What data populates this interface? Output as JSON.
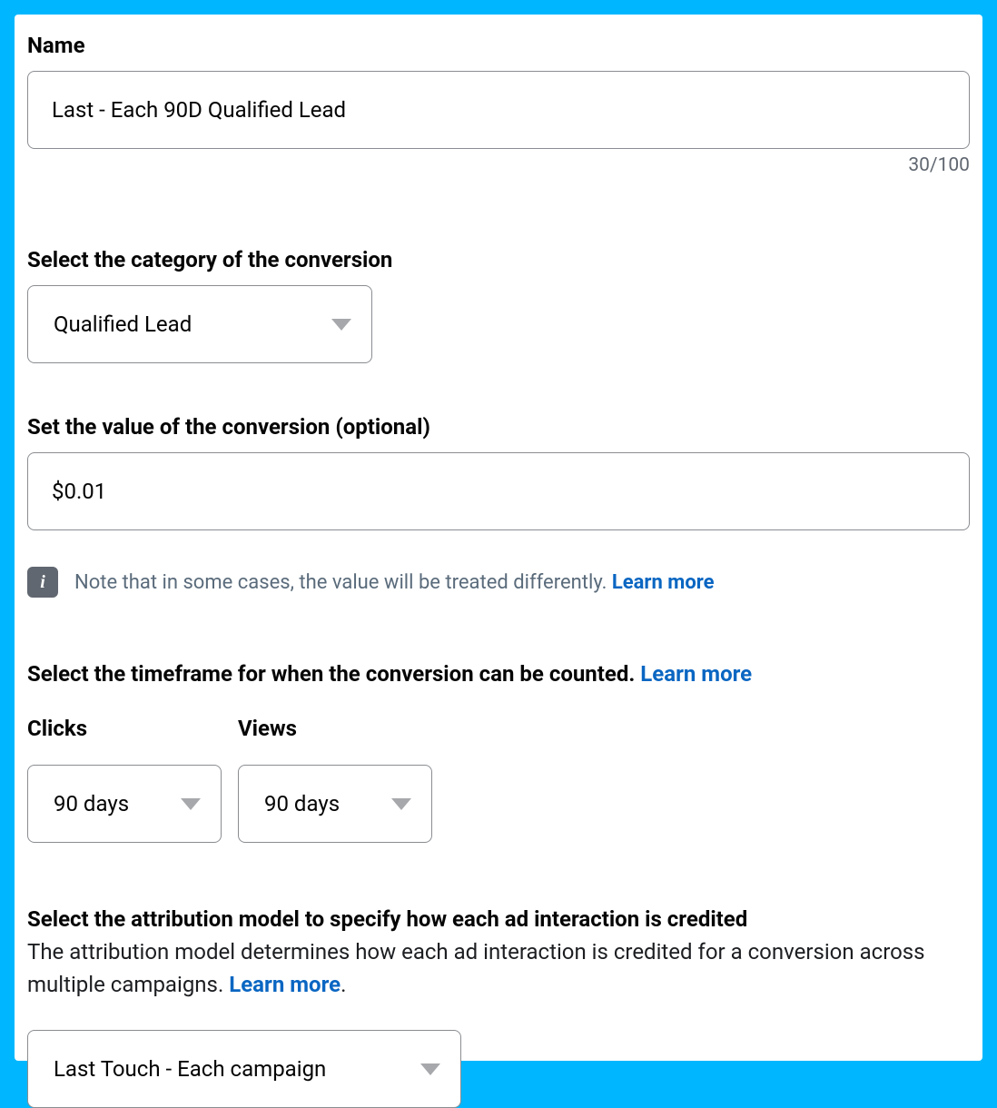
{
  "name": {
    "label": "Name",
    "value": "Last - Each 90D Qualified Lead",
    "counter": "30/100"
  },
  "category": {
    "label": "Select the category of the conversion",
    "selected": "Qualified Lead"
  },
  "value_field": {
    "label": "Set the value of the conversion (optional)",
    "value": "$0.01",
    "note_prefix": "Note that in some cases, the value will be treated differently. ",
    "learn_more": "Learn more"
  },
  "timeframe": {
    "heading_prefix": "Select the timeframe for when the conversion can be counted. ",
    "learn_more": "Learn more",
    "clicks_label": "Clicks",
    "clicks_value": "90 days",
    "views_label": "Views",
    "views_value": "90 days"
  },
  "attribution": {
    "heading": "Select the attribution model to specify how each ad interaction is credited",
    "body_prefix": "The attribution model determines how each ad interaction is credited for a conversion across multiple campaigns. ",
    "learn_more": "Learn more",
    "body_suffix": ".",
    "selected": "Last Touch - Each campaign"
  }
}
